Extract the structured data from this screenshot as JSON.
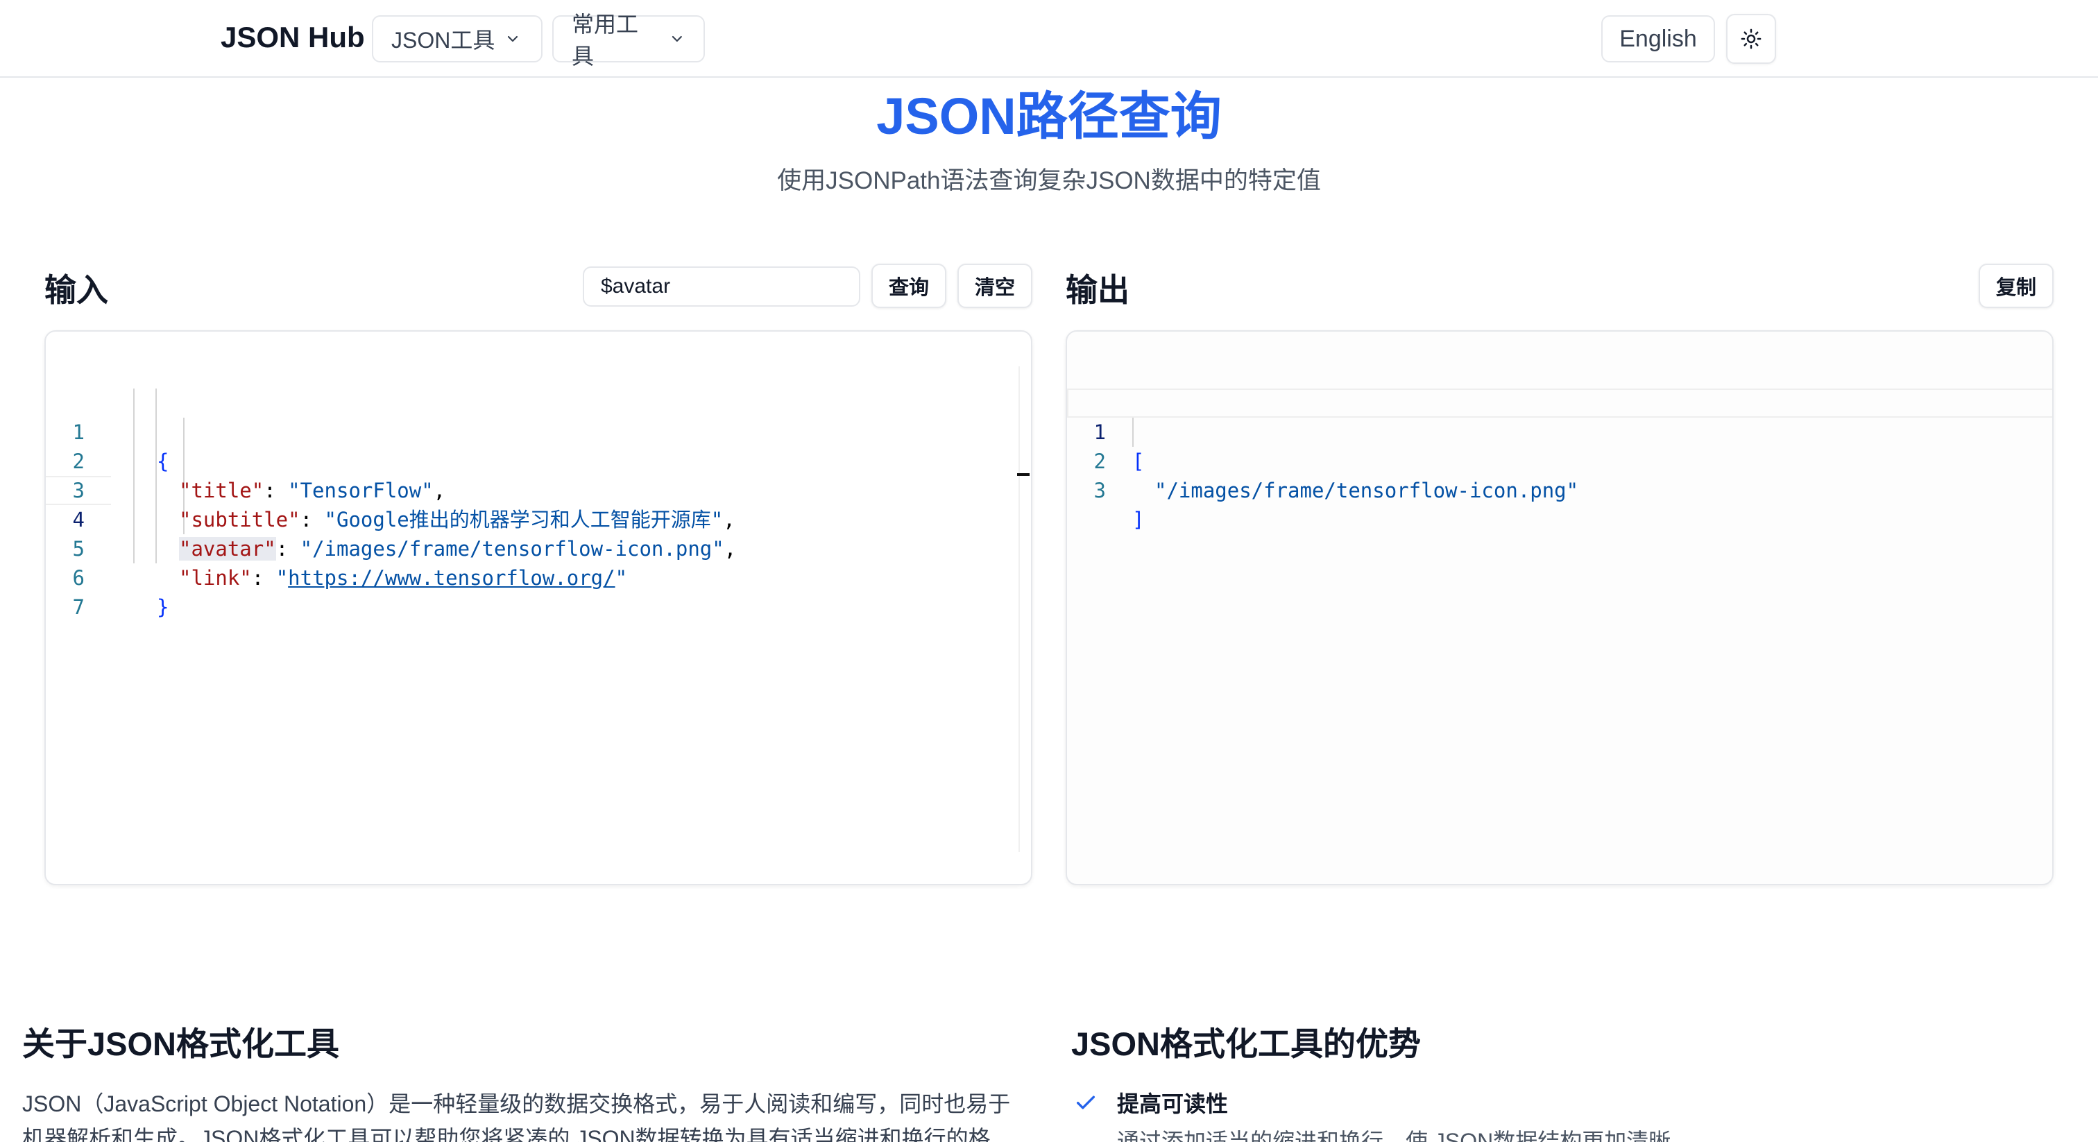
{
  "header": {
    "brand": "JSON Hub",
    "nav": [
      {
        "label": "JSON工具",
        "icon": "chevron-down-icon"
      },
      {
        "label": "常用工具",
        "icon": "chevron-down-icon"
      }
    ],
    "language": "English",
    "theme_icon": "sun-icon"
  },
  "hero": {
    "title": "JSON路径查询",
    "subtitle": "使用JSONPath语法查询复杂JSON数据中的特定值"
  },
  "input_panel": {
    "label": "输入",
    "query_value": "$avatar",
    "query_button": "查询",
    "clear_button": "清空",
    "line_numbers": [
      "1",
      "2",
      "3",
      "4",
      "5",
      "6",
      "7"
    ],
    "active_line": "4",
    "code": {
      "open_brace": "{",
      "close_brace": "}",
      "entries": [
        {
          "key": "\"title\"",
          "value": "\"TensorFlow\""
        },
        {
          "key": "\"subtitle\"",
          "value": "\"Google推出的机器学习和人工智能开源库\""
        },
        {
          "key": "\"avatar\"",
          "value": "\"/images/frame/tensorflow-icon.png\""
        },
        {
          "key": "\"link\"",
          "value_prefix": "\"",
          "value_link": "https://www.tensorflow.org/",
          "value_suffix": "\""
        }
      ]
    }
  },
  "output_panel": {
    "label": "输出",
    "copy_button": "复制",
    "line_numbers": [
      "1",
      "2",
      "3"
    ],
    "active_line": "1",
    "code": {
      "open": "[",
      "value": "\"/images/frame/tensorflow-icon.png\"",
      "close": "]"
    }
  },
  "about": {
    "title": "关于JSON格式化工具",
    "text": "JSON（JavaScript Object Notation）是一种轻量级的数据交换格式，易于人阅读和编写，同时也易于机器解析和生成。JSON格式化工具可以帮助您将紧凑的 JSON数据转换为具有适当缩进和换行的格"
  },
  "advantages": {
    "title": "JSON格式化工具的优势",
    "items": [
      {
        "icon": "check-icon",
        "title": "提高可读性",
        "desc": "通过添加适当的缩进和换行，使 JSON数据结构更加清晰"
      }
    ]
  },
  "colors": {
    "accent": "#2563eb",
    "json_key": "#a31515",
    "json_string": "#0451a5",
    "bracket": "#0431fa",
    "line_number": "#237893"
  }
}
